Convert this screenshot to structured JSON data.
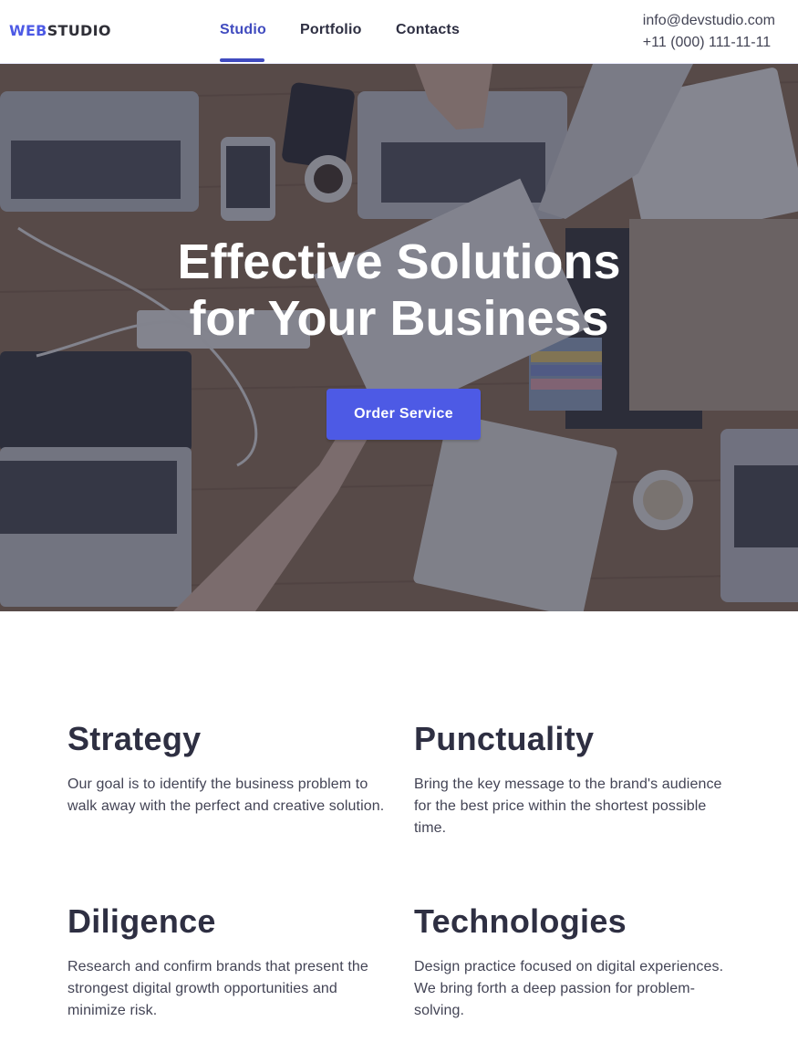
{
  "header": {
    "logo": {
      "accent": "WEB",
      "rest": "STUDIO"
    },
    "nav": [
      {
        "label": "Studio",
        "active": true
      },
      {
        "label": "Portfolio",
        "active": false
      },
      {
        "label": "Contacts",
        "active": false
      }
    ],
    "contacts": {
      "email": "info@devstudio.com",
      "phone": "+11 (000) 111-11-11"
    }
  },
  "hero": {
    "title_line1": "Effective Solutions",
    "title_line2": "for Your Business",
    "button_label": "Order Service",
    "image": "team-workspace-photo"
  },
  "features": [
    {
      "title": "Strategy",
      "text": "Our goal is to identify the business problem to walk away with the perfect and creative solution."
    },
    {
      "title": "Punctuality",
      "text": "Bring the key message to the brand's audience for the best price within the shortest possible time."
    },
    {
      "title": "Diligence",
      "text": "Research and confirm brands that present the strongest digital growth opportunities and minimize risk."
    },
    {
      "title": "Technologies",
      "text": "Design practice focused on digital experiences. We bring forth a deep passion for problem-solving."
    }
  ],
  "colors": {
    "accent": "#4d5ae5",
    "nav_active": "#404bbf",
    "heading": "#2e2f42",
    "body_text": "#434455"
  }
}
